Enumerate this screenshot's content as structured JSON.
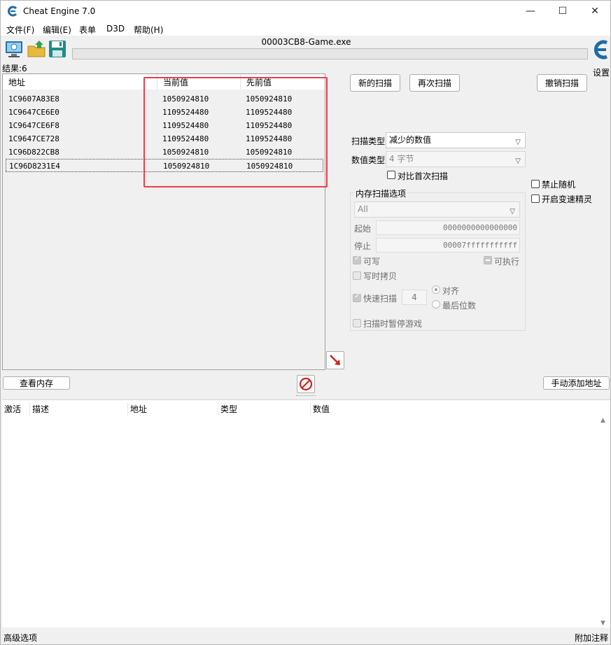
{
  "window": {
    "title": "Cheat Engine 7.0",
    "minimize_glyph": "—",
    "maximize_glyph": "☐",
    "close_glyph": "✕"
  },
  "menu": [
    "文件(F)",
    "编辑(E)",
    "表单",
    "D3D",
    "帮助(H)"
  ],
  "toolbar": {
    "icons": [
      "open-process-icon",
      "open-file-icon",
      "save-icon"
    ],
    "process_name": "00003CB8-Game.exe",
    "progress": 0,
    "settings_label": "设置"
  },
  "results": {
    "count_label": "结果:6",
    "columns": [
      "地址",
      "当前值",
      "先前值"
    ],
    "rows": [
      {
        "address": "1C9607A83E8",
        "current": "1050924810",
        "previous": "1050924810"
      },
      {
        "address": "1C9647CE6E0",
        "current": "1109524480",
        "previous": "1109524480"
      },
      {
        "address": "1C9647CE6F8",
        "current": "1109524480",
        "previous": "1109524480"
      },
      {
        "address": "1C9647CE728",
        "current": "1109524480",
        "previous": "1109524480"
      },
      {
        "address": "1C96D822CB8",
        "current": "1050924810",
        "previous": "1050924810"
      },
      {
        "address": "1C96D8231E4",
        "current": "1050924810",
        "previous": "1050924810"
      }
    ],
    "selected_row": 5
  },
  "scan": {
    "new_scan": "新的扫描",
    "next_scan": "再次扫描",
    "undo_scan": "撤销扫描",
    "scan_type_label": "扫描类型",
    "scan_type_value": "减少的数值",
    "value_type_label": "数值类型",
    "value_type_value": "4 字节",
    "compare_first_label": "对比首次扫描",
    "disable_random_label": "禁止随机",
    "speedhack_label": "开启变速精灵"
  },
  "memory_options": {
    "title": "内存扫描选项",
    "region_value": "All",
    "start_label": "起始",
    "start_value": "0000000000000000",
    "stop_label": "停止",
    "stop_value": "00007fffffffffff",
    "writable_label": "可写",
    "executable_label": "可执行",
    "copy_on_write_label": "写时拷贝",
    "fast_scan_label": "快速扫描",
    "fast_scan_value": "4",
    "align_label": "对齐",
    "last_digits_label": "最后位数",
    "pause_game_label": "扫描时暂停游戏"
  },
  "bottom_buttons": {
    "view_memory": "查看内存",
    "add_address": "手动添加地址"
  },
  "address_list": {
    "columns": [
      "激活",
      "描述",
      "地址",
      "类型",
      "数值"
    ]
  },
  "statusbar": {
    "advanced": "高级选项",
    "comments": "附加注释"
  },
  "colors": {
    "highlight": "#e8404d",
    "window_bg": "#f0f0f0"
  }
}
